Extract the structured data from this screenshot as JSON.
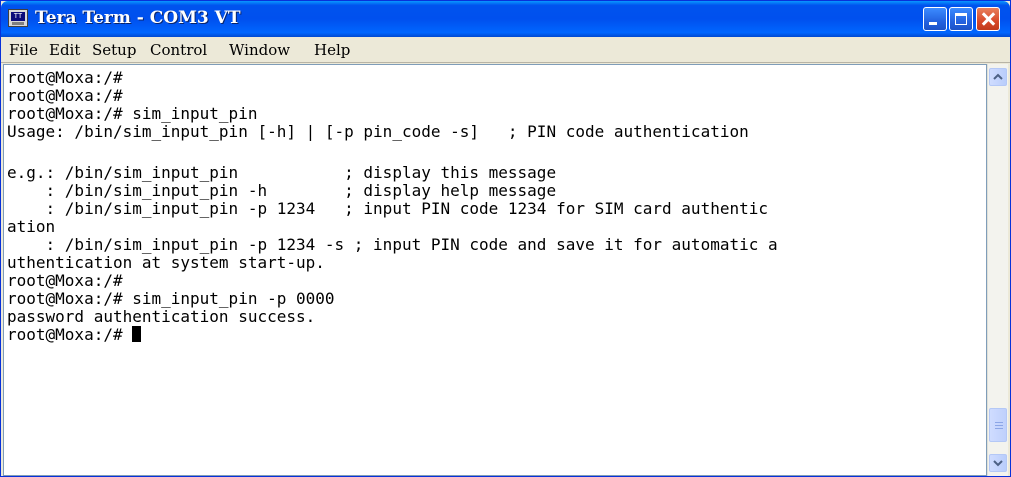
{
  "window": {
    "title": "Tera Term - COM3 VT",
    "app_icon_text": "TT",
    "icon": "tera-term-icon"
  },
  "menu": {
    "items": [
      "File",
      "Edit",
      "Setup",
      "Control",
      "Window",
      "Help"
    ]
  },
  "terminal": {
    "lines": [
      "root@Moxa:/#",
      "root@Moxa:/#",
      "root@Moxa:/# sim_input_pin",
      "Usage: /bin/sim_input_pin [-h] | [-p pin_code -s]   ; PIN code authentication",
      "",
      "e.g.: /bin/sim_input_pin           ; display this message",
      "    : /bin/sim_input_pin -h        ; display help message",
      "    : /bin/sim_input_pin -p 1234   ; input PIN code 1234 for SIM card authentic",
      "ation",
      "    : /bin/sim_input_pin -p 1234 -s ; input PIN code and save it for automatic a",
      "uthentication at system start-up.",
      "root@Moxa:/#",
      "root@Moxa:/# sim_input_pin -p 0000",
      "password authentication success.",
      "root@Moxa:/# "
    ]
  },
  "scrollbar": {
    "position_fraction": 1.0
  }
}
